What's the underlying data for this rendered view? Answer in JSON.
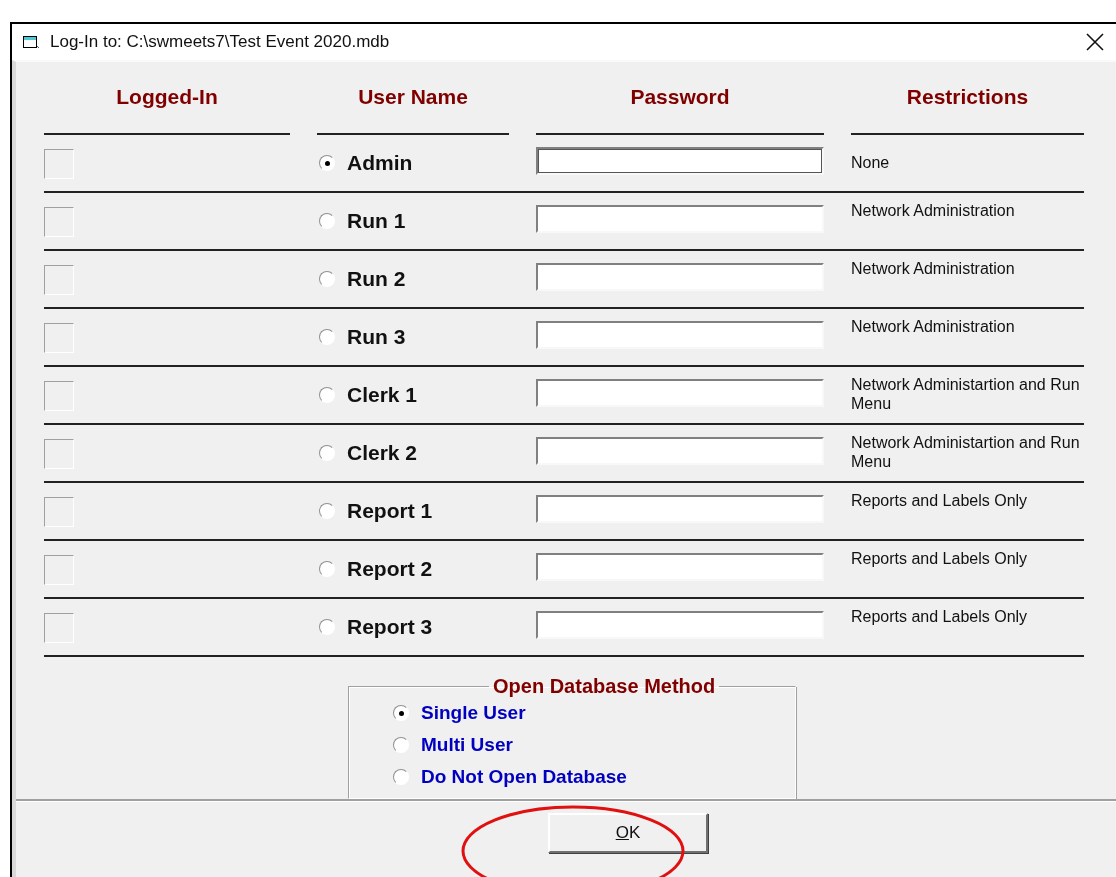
{
  "window": {
    "title": "Log-In to:  C:\\swmeets7\\Test Event 2020.mdb"
  },
  "columns": [
    "Logged-In",
    "User Name",
    "Password",
    "Restrictions"
  ],
  "users": [
    {
      "logged_in": false,
      "name": "Admin",
      "selected": true,
      "focused": true,
      "restrictions": "None"
    },
    {
      "logged_in": false,
      "name": "Run 1",
      "selected": false,
      "focused": false,
      "restrictions": "Network Administration"
    },
    {
      "logged_in": false,
      "name": "Run 2",
      "selected": false,
      "focused": false,
      "restrictions": "Network Administration"
    },
    {
      "logged_in": false,
      "name": "Run 3",
      "selected": false,
      "focused": false,
      "restrictions": "Network Administration"
    },
    {
      "logged_in": false,
      "name": "Clerk 1",
      "selected": false,
      "focused": false,
      "restrictions": "Network Administartion and Run Menu"
    },
    {
      "logged_in": false,
      "name": "Clerk 2",
      "selected": false,
      "focused": false,
      "restrictions": "Network Administartion and Run Menu"
    },
    {
      "logged_in": false,
      "name": "Report 1",
      "selected": false,
      "focused": false,
      "restrictions": "Reports and Labels Only"
    },
    {
      "logged_in": false,
      "name": "Report 2",
      "selected": false,
      "focused": false,
      "restrictions": "Reports and Labels Only"
    },
    {
      "logged_in": false,
      "name": "Report 3",
      "selected": false,
      "focused": false,
      "restrictions": "Reports and Labels Only"
    }
  ],
  "open_method": {
    "title": "Open Database Method",
    "options": [
      {
        "label": "Single User",
        "selected": true
      },
      {
        "label": "Multi User",
        "selected": false
      },
      {
        "label": "Do Not Open Database",
        "selected": false
      }
    ]
  },
  "buttons": [
    {
      "label": "OK",
      "highlighted": true
    }
  ]
}
